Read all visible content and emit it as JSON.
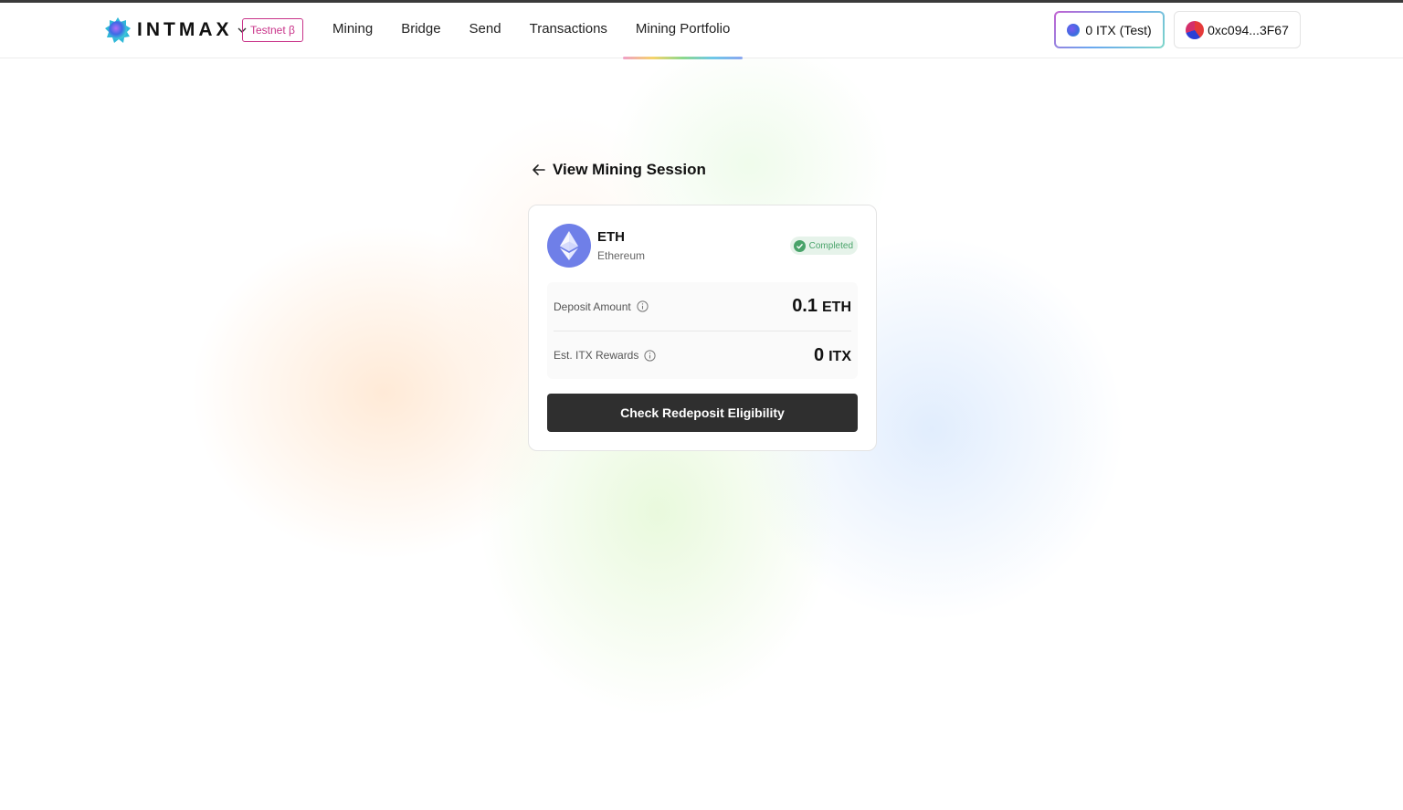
{
  "header": {
    "logo_text": "INTMAX",
    "network_badge": "Testnet β",
    "nav": [
      {
        "label": "Mining"
      },
      {
        "label": "Bridge"
      },
      {
        "label": "Send"
      },
      {
        "label": "Transactions"
      },
      {
        "label": "Mining Portfolio",
        "active": true
      }
    ],
    "balance_label": "0 ITX (Test)",
    "wallet_address": "0xc094...3F67"
  },
  "page": {
    "title": "View Mining Session"
  },
  "session": {
    "token_symbol": "ETH",
    "token_name": "Ethereum",
    "status": "Completed",
    "deposit_label": "Deposit Amount",
    "deposit_value": "0.1",
    "deposit_unit": "ETH",
    "rewards_label": "Est. ITX Rewards",
    "rewards_value": "0",
    "rewards_unit": "ITX",
    "cta_label": "Check Redeposit Eligibility"
  },
  "colors": {
    "status_green": "#49a36a",
    "testnet_pink": "#c9348a",
    "eth_blue": "#6f7fe8",
    "cta_dark": "#2f2f2f"
  }
}
